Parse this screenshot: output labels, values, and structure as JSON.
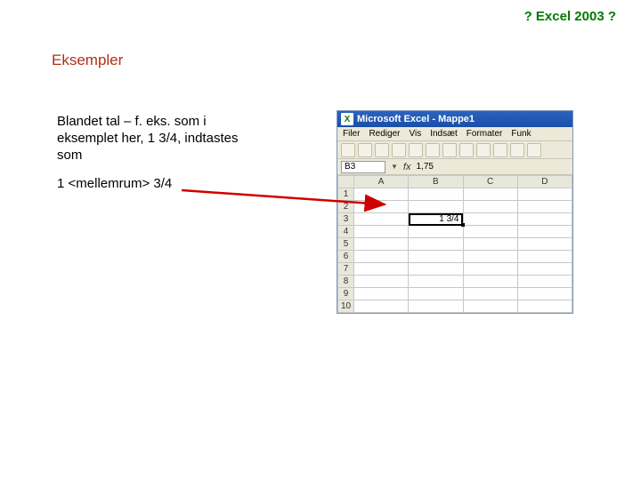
{
  "header": "? Excel 2003 ?",
  "subtitle": "Eksempler",
  "body": {
    "p1": "Blandet tal – f. eks. som i eksemplet her, 1 3/4, indtastes som",
    "p2": "1 <mellemrum> 3/4"
  },
  "excel": {
    "title": "Microsoft Excel - Mappe1",
    "menus": [
      "Filer",
      "Rediger",
      "Vis",
      "Indsæt",
      "Formater",
      "Funk"
    ],
    "namebox": "B3",
    "fx_label": "fx",
    "fx_value": "1,75",
    "columns": [
      "A",
      "B",
      "C",
      "D"
    ],
    "rows": [
      "1",
      "2",
      "3",
      "4",
      "5",
      "6",
      "7",
      "8",
      "9",
      "10"
    ],
    "active_cell": {
      "row": 3,
      "col": "B",
      "value": "1 3/4"
    }
  }
}
